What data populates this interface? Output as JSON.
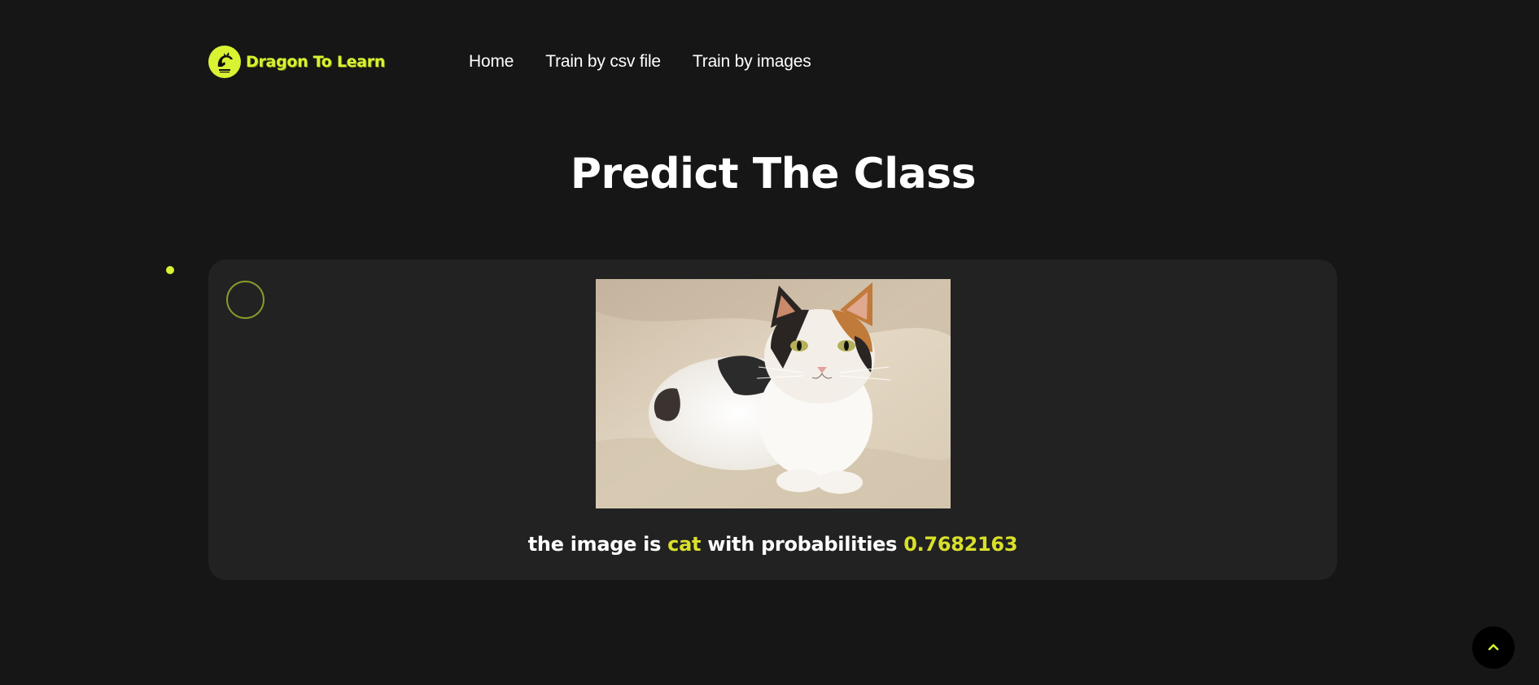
{
  "brand": {
    "name": "Dragon To Learn",
    "logo_icon": "dragon-logo-icon",
    "accent_color": "#d9f232"
  },
  "nav": {
    "items": [
      {
        "label": "Home"
      },
      {
        "label": "Train by csv file"
      },
      {
        "label": "Train by images"
      }
    ]
  },
  "page": {
    "title": "Predict The Class",
    "background_color": "#161617",
    "card_color": "#222223"
  },
  "prediction": {
    "prefix": "the image is",
    "class_label": "cat",
    "middle": "with probabilities",
    "probability": "0.7682163",
    "highlight_color": "#d9e02a"
  },
  "scroll_top": {
    "icon": "chevron-up-icon"
  }
}
